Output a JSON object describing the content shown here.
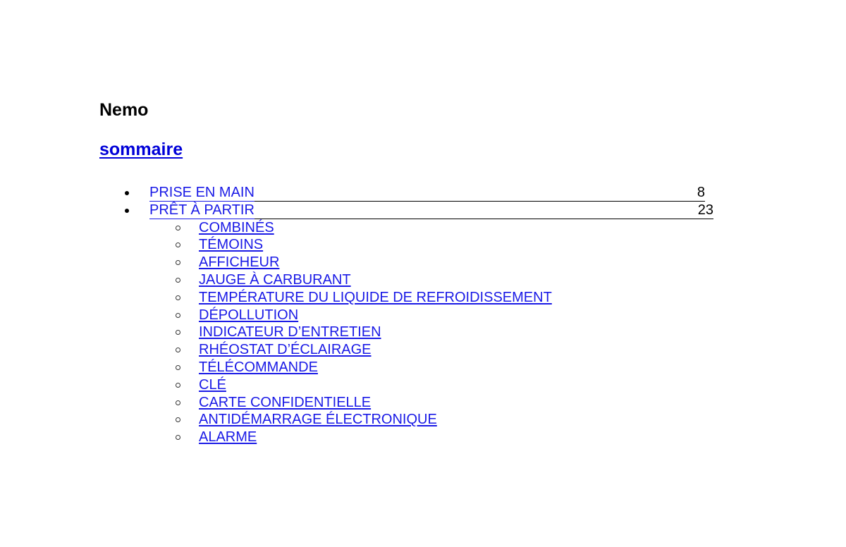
{
  "document": {
    "title": "Nemo",
    "toc_heading": "sommaire"
  },
  "toc": {
    "entries": [
      {
        "label": "PRISE EN MAIN",
        "page": "8"
      },
      {
        "label": "PRÊT À PARTIR",
        "page": "23"
      }
    ],
    "subentries": [
      {
        "label": "COMBINÉS"
      },
      {
        "label": "TÉMOINS"
      },
      {
        "label": "AFFICHEUR"
      },
      {
        "label": "JAUGE À CARBURANT"
      },
      {
        "label": "TEMPÉRATURE DU LIQUIDE DE REFROIDISSEMENT"
      },
      {
        "label": "DÉPOLLUTION"
      },
      {
        "label": "INDICATEUR D’ENTRETIEN"
      },
      {
        "label": "RHÉOSTAT D’ÉCLAIRAGE"
      },
      {
        "label": "TÉLÉCOMMANDE"
      },
      {
        "label": "CLÉ"
      },
      {
        "label": "CARTE CONFIDENTIELLE"
      },
      {
        "label": "ANTIDÉMARRAGE ÉLECTRONIQUE"
      },
      {
        "label": "ALARME"
      }
    ]
  },
  "colors": {
    "link": "#1a1ae6",
    "heading_link": "#0000d8",
    "text": "#000000"
  }
}
